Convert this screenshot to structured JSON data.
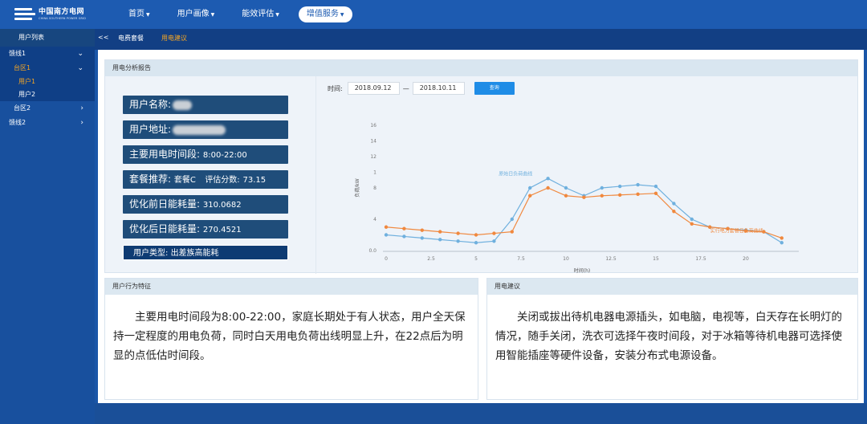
{
  "logo": {
    "title": "中国南方电网",
    "subtitle": "CHINA SOUTHERN POWER GRID"
  },
  "nav": {
    "items": [
      {
        "label": "首页"
      },
      {
        "label": "用户画像"
      },
      {
        "label": "能效评估"
      },
      {
        "label": "增值服务"
      }
    ],
    "active_index": 3
  },
  "sidebar": {
    "title": "用户列表",
    "items": [
      {
        "label": "馈线1"
      },
      {
        "label": "台区1"
      },
      {
        "label": "用户1"
      },
      {
        "label": "用户2"
      },
      {
        "label": "台区2"
      },
      {
        "label": "馈线2"
      }
    ]
  },
  "tabs": {
    "collapse": "<<",
    "items": [
      {
        "label": "电费套餐"
      },
      {
        "label": "用电建议"
      }
    ]
  },
  "report": {
    "title": "用电分析报告",
    "name_label": "用户名称:",
    "address_label": "用户地址:",
    "period_label": "主要用电时间段:",
    "period_value": "8:00-22:00",
    "package_label": "套餐推荐:",
    "package_value": "套餐C",
    "score_label": "评估分数:",
    "score_value": "73.15",
    "before_label": "优化前日能耗量:",
    "before_value": "310.0682",
    "after_label": "优化后日能耗量:",
    "after_value": "270.4521",
    "type_label": "用户类型:",
    "type_value": "出差族高能耗",
    "time_label": "时间:",
    "date_from": "2018.09.12",
    "date_to": "2018.10.11",
    "query_label": "查询"
  },
  "behavior": {
    "title": "用户行为特征",
    "text": "主要用电时间段为8:00-22:00，家庭长期处于有人状态，用户全天保持一定程度的用电负荷，同时白天用电负荷出线明显上升，在22点后为明显的点低估时间段。"
  },
  "advice": {
    "title": "用电建议",
    "text": "关闭或拔出待机电器电源插头，如电脑，电视等，白天存在长明灯的情况，随手关闭，洗衣可选择午夜时间段，对于冰箱等待机电器可选择使用智能插座等硬件设备，安装分布式电源设备。"
  },
  "chart_data": {
    "type": "line",
    "xlabel": "时间(h)",
    "ylabel": "负荷/kW",
    "xlim": [
      0,
      22.5
    ],
    "ylim": [
      0,
      16
    ],
    "xticks": [
      0,
      2.5,
      5,
      7.5,
      10,
      12.5,
      15,
      17.5,
      20
    ],
    "yticks": [
      0.0,
      0.4,
      0.8,
      1.2,
      1.6
    ],
    "ytick_labels": [
      "0.0",
      "4",
      "8",
      "1",
      "12",
      "14",
      "16"
    ],
    "grid": false,
    "colors": {
      "original": "#6fb0de",
      "applied": "#f0883e"
    },
    "series": [
      {
        "name": "原始日负荷曲线",
        "x": [
          0,
          1,
          2,
          3,
          4,
          5,
          6,
          7,
          8,
          9,
          10,
          11,
          12,
          13,
          14,
          15,
          16,
          17,
          18,
          19,
          20,
          21,
          22
        ],
        "values": [
          2.0,
          1.8,
          1.6,
          1.4,
          1.2,
          1.0,
          1.2,
          4.0,
          8.0,
          9.2,
          8.0,
          7.0,
          8.0,
          8.2,
          8.4,
          8.2,
          6.0,
          4.0,
          3.0,
          2.8,
          2.6,
          2.4,
          1.0
        ]
      },
      {
        "name": "实行电力套餐日负荷曲线",
        "x": [
          0,
          1,
          2,
          3,
          4,
          5,
          6,
          7,
          8,
          9,
          10,
          11,
          12,
          13,
          14,
          15,
          16,
          17,
          18,
          19,
          20,
          21,
          22
        ],
        "values": [
          3.0,
          2.8,
          2.6,
          2.4,
          2.2,
          2.0,
          2.2,
          2.4,
          7.0,
          8.0,
          7.0,
          6.8,
          7.0,
          7.1,
          7.2,
          7.3,
          5.0,
          3.4,
          3.0,
          2.8,
          2.5,
          2.4,
          1.6
        ]
      }
    ]
  }
}
